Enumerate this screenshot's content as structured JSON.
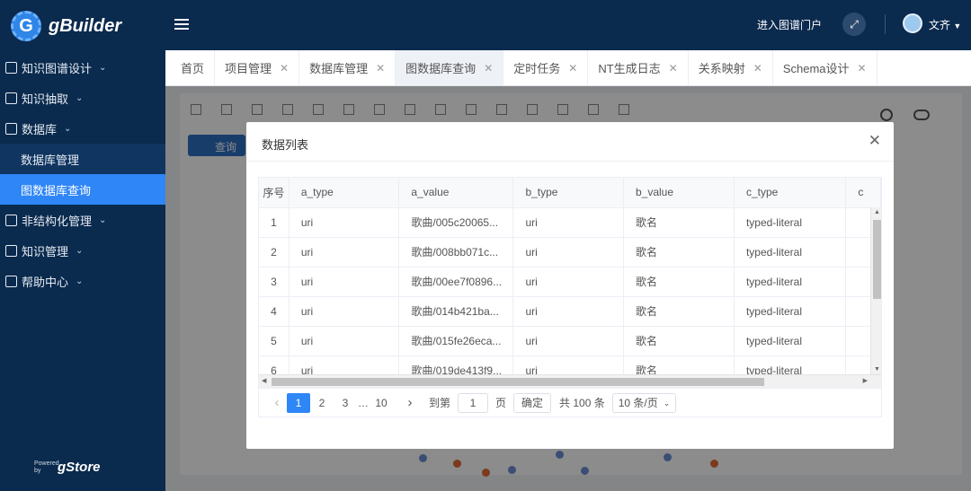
{
  "app": {
    "name": "gBuilder",
    "powered_by_small": "Powered by",
    "powered_brand": "gStore"
  },
  "sidebar": {
    "items": [
      {
        "label": "知识图谱设计",
        "expanded": false
      },
      {
        "label": "知识抽取",
        "expanded": false
      },
      {
        "label": "数据库",
        "expanded": true,
        "children": [
          {
            "label": "数据库管理",
            "active": false
          },
          {
            "label": "图数据库查询",
            "active": true
          }
        ]
      },
      {
        "label": "非结构化管理",
        "expanded": false
      },
      {
        "label": "知识管理",
        "expanded": false
      },
      {
        "label": "帮助中心",
        "expanded": false
      }
    ]
  },
  "header": {
    "portal_link": "进入图谱门户",
    "user_name": "文齐"
  },
  "tabs": [
    {
      "label": "首页",
      "closable": false
    },
    {
      "label": "项目管理",
      "closable": true
    },
    {
      "label": "数据库管理",
      "closable": true
    },
    {
      "label": "图数据库查询",
      "closable": true,
      "active": true
    },
    {
      "label": "定时任务",
      "closable": true
    },
    {
      "label": "NT生成日志",
      "closable": true
    },
    {
      "label": "关系映射",
      "closable": true
    },
    {
      "label": "Schema设计",
      "closable": true
    }
  ],
  "background": {
    "query_button": "查询"
  },
  "modal": {
    "title": "数据列表",
    "table": {
      "columns": [
        "序号",
        "a_type",
        "a_value",
        "b_type",
        "b_value",
        "c_type",
        "c"
      ],
      "rows": [
        [
          "1",
          "uri",
          "歌曲/005c20065...",
          "uri",
          "歌名",
          "typed-literal"
        ],
        [
          "2",
          "uri",
          "歌曲/008bb071c...",
          "uri",
          "歌名",
          "typed-literal"
        ],
        [
          "3",
          "uri",
          "歌曲/00ee7f0896...",
          "uri",
          "歌名",
          "typed-literal"
        ],
        [
          "4",
          "uri",
          "歌曲/014b421ba...",
          "uri",
          "歌名",
          "typed-literal"
        ],
        [
          "5",
          "uri",
          "歌曲/015fe26eca...",
          "uri",
          "歌名",
          "typed-literal"
        ],
        [
          "6",
          "uri",
          "歌曲/019de413f9...",
          "uri",
          "歌名",
          "typed-literal"
        ]
      ]
    },
    "pagination": {
      "pages": [
        "1",
        "2",
        "3",
        "…",
        "10"
      ],
      "current_page": "1",
      "goto_label": "到第",
      "goto_value": "1",
      "page_unit": "页",
      "confirm_label": "确定",
      "total_label": "共 100 条",
      "page_size": "10 条/页"
    }
  },
  "colors": {
    "sidebar_bg": "#0a2a4e",
    "accent": "#2f86f6"
  }
}
